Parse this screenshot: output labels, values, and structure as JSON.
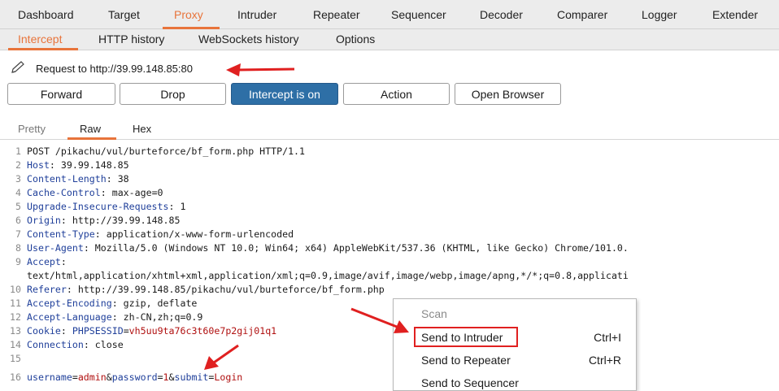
{
  "top_tabs": [
    "Dashboard",
    "Target",
    "Proxy",
    "Intruder",
    "Repeater",
    "Sequencer",
    "Decoder",
    "Comparer",
    "Logger",
    "Extender"
  ],
  "active_top_tab": "Proxy",
  "sub_tabs": [
    "Intercept",
    "HTTP history",
    "WebSockets history",
    "Options"
  ],
  "active_sub_tab": "Intercept",
  "request_label": "Request to http://39.99.148.85:80",
  "toolbar": {
    "forward": "Forward",
    "drop": "Drop",
    "intercept": "Intercept is on",
    "action": "Action",
    "open_browser": "Open Browser"
  },
  "editor_tabs": [
    "Pretty",
    "Raw",
    "Hex"
  ],
  "active_editor_tab": "Raw",
  "request_lines": [
    {
      "n": "1",
      "parts": [
        {
          "t": "POST /pikachu/vul/burteforce/bf_form.php HTTP/1.1",
          "c": "pe"
        }
      ]
    },
    {
      "n": "2",
      "parts": [
        {
          "t": "Host",
          "c": "hk"
        },
        {
          "t": ": 39.99.148.85",
          "c": "pe"
        }
      ]
    },
    {
      "n": "3",
      "parts": [
        {
          "t": "Content-Length",
          "c": "hk"
        },
        {
          "t": ": 38",
          "c": "pe"
        }
      ]
    },
    {
      "n": "4",
      "parts": [
        {
          "t": "Cache-Control",
          "c": "hk"
        },
        {
          "t": ": max-age=0",
          "c": "pe"
        }
      ]
    },
    {
      "n": "5",
      "parts": [
        {
          "t": "Upgrade-Insecure-Requests",
          "c": "hk"
        },
        {
          "t": ": 1",
          "c": "pe"
        }
      ]
    },
    {
      "n": "6",
      "parts": [
        {
          "t": "Origin",
          "c": "hk"
        },
        {
          "t": ": http://39.99.148.85",
          "c": "pe"
        }
      ]
    },
    {
      "n": "7",
      "parts": [
        {
          "t": "Content-Type",
          "c": "hk"
        },
        {
          "t": ": application/x-www-form-urlencoded",
          "c": "pe"
        }
      ]
    },
    {
      "n": "8",
      "parts": [
        {
          "t": "User-Agent",
          "c": "hk"
        },
        {
          "t": ": Mozilla/5.0 (Windows NT 10.0; Win64; x64) AppleWebKit/537.36 (KHTML, like Gecko) Chrome/101.0.",
          "c": "pe"
        }
      ]
    },
    {
      "n": "9",
      "parts": [
        {
          "t": "Accept",
          "c": "hk"
        },
        {
          "t": ":",
          "c": "pe"
        }
      ]
    },
    {
      "n": "",
      "parts": [
        {
          "t": "text/html,application/xhtml+xml,application/xml;q=0.9,image/avif,image/webp,image/apng,*/*;q=0.8,applicati",
          "c": "pe"
        }
      ]
    },
    {
      "n": "10",
      "parts": [
        {
          "t": "Referer",
          "c": "hk"
        },
        {
          "t": ": http://39.99.148.85/pikachu/vul/burteforce/bf_form.php",
          "c": "pe"
        }
      ]
    },
    {
      "n": "11",
      "parts": [
        {
          "t": "Accept-Encoding",
          "c": "hk"
        },
        {
          "t": ": gzip, deflate",
          "c": "pe"
        }
      ]
    },
    {
      "n": "12",
      "parts": [
        {
          "t": "Accept-Language",
          "c": "hk"
        },
        {
          "t": ": zh-CN,zh;q=0.9",
          "c": "pe"
        }
      ]
    },
    {
      "n": "13",
      "parts": [
        {
          "t": "Cookie",
          "c": "hk"
        },
        {
          "t": ": ",
          "c": "pe"
        },
        {
          "t": "PHPSESSID",
          "c": "pk"
        },
        {
          "t": "=",
          "c": "pe"
        },
        {
          "t": "vh5uu9ta76c3t60e7p2gij01q1",
          "c": "pv"
        }
      ]
    },
    {
      "n": "14",
      "parts": [
        {
          "t": "Connection",
          "c": "hk"
        },
        {
          "t": ": close",
          "c": "pe"
        }
      ]
    },
    {
      "n": "15",
      "parts": []
    },
    {
      "n": "16",
      "parts": [
        {
          "t": "username",
          "c": "pk"
        },
        {
          "t": "=",
          "c": "pe"
        },
        {
          "t": "admin",
          "c": "pv"
        },
        {
          "t": "&",
          "c": "pe"
        },
        {
          "t": "password",
          "c": "pk"
        },
        {
          "t": "=",
          "c": "pe"
        },
        {
          "t": "1",
          "c": "pv"
        },
        {
          "t": "&",
          "c": "pe"
        },
        {
          "t": "submit",
          "c": "pk"
        },
        {
          "t": "=",
          "c": "pe"
        },
        {
          "t": "Login",
          "c": "pv"
        }
      ]
    }
  ],
  "context_menu": [
    {
      "label": "Scan",
      "shortcut": "",
      "disabled": true
    },
    {
      "label": "Send to Intruder",
      "shortcut": "Ctrl+I",
      "disabled": false
    },
    {
      "label": "Send to Repeater",
      "shortcut": "Ctrl+R",
      "disabled": false
    },
    {
      "label": "Send to Sequencer",
      "shortcut": "",
      "disabled": false
    }
  ],
  "colors": {
    "accent": "#e8743b",
    "intercept_button": "#2e6fa6",
    "header_key": "#1f3f9a",
    "param_value": "#b01010",
    "annotation": "#e02020"
  }
}
